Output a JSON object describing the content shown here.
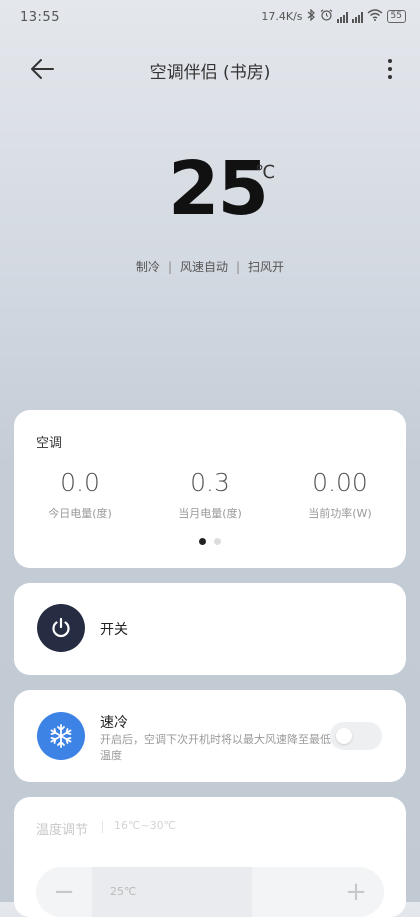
{
  "status_bar": {
    "time": "13:55",
    "speed": "17.4K/s",
    "battery": "55"
  },
  "header": {
    "title": "空调伴侣 (书房)",
    "back_icon": "arrow-left-icon",
    "more_icon": "more-vertical-icon"
  },
  "hero": {
    "temperature": "25",
    "unit": "℃",
    "modes": [
      "制冷",
      "风速自动",
      "扫风开"
    ]
  },
  "energy_card": {
    "title": "空调",
    "stats": [
      {
        "value": "0.0",
        "label": "今日电量(度)"
      },
      {
        "value": "0.3",
        "label": "当月电量(度)"
      },
      {
        "value": "0.00",
        "label": "当前功率(W)"
      }
    ],
    "page_count": 2,
    "active_page": 0
  },
  "power_card": {
    "label": "开关",
    "icon": "power-icon"
  },
  "quick_cool_card": {
    "label": "速冷",
    "description": "开启后，空调下次开机时将以最大风速降至最低温度",
    "icon": "snowflake-icon",
    "enabled": false
  },
  "temp_card": {
    "label": "温度调节",
    "range": "16℃~30℃",
    "current": "25℃",
    "minus": "−",
    "plus": "+"
  },
  "colors": {
    "power_bg": "#262c42",
    "snow_bg": "#3d83e6"
  }
}
